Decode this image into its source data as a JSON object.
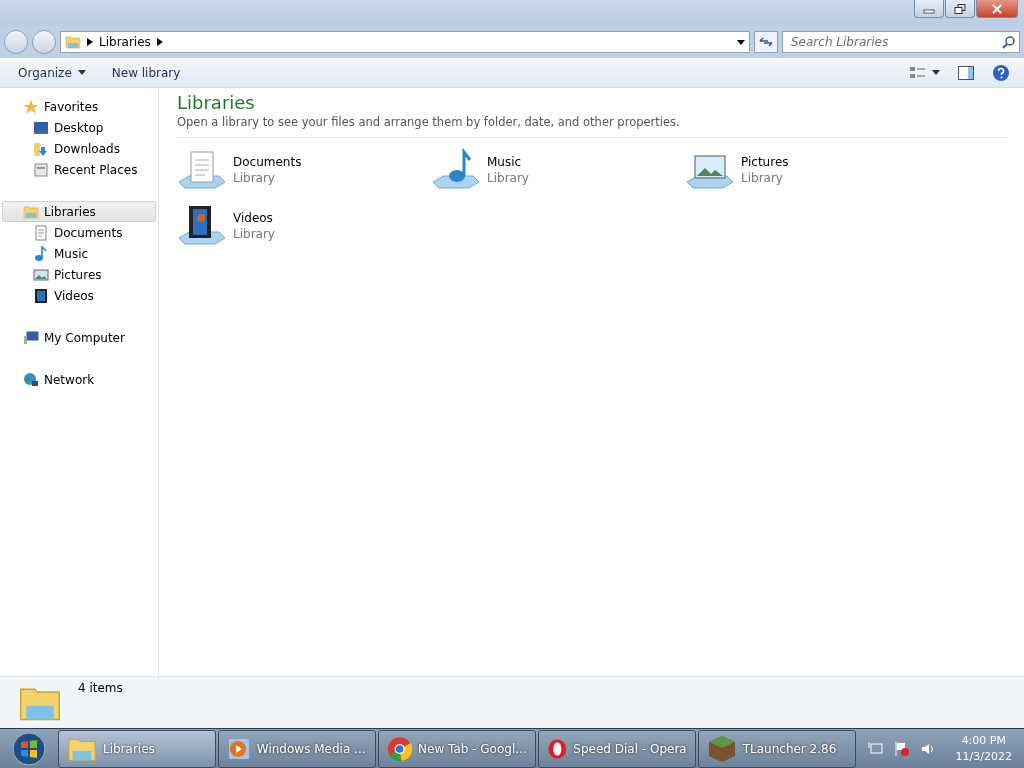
{
  "address_bar": {
    "path": "Libraries"
  },
  "search": {
    "placeholder": "Search Libraries"
  },
  "toolbar": {
    "buttons": [
      "Organize",
      "New library"
    ]
  },
  "nav": [
    {
      "label": "Favorites",
      "selected": false,
      "children": [
        {
          "label": "Desktop",
          "selected": false
        },
        {
          "label": "Downloads",
          "selected": false
        },
        {
          "label": "Recent Places",
          "selected": false
        }
      ]
    },
    {
      "label": "Libraries",
      "selected": true,
      "children": [
        {
          "label": "Documents",
          "selected": false
        },
        {
          "label": "Music",
          "selected": false
        },
        {
          "label": "Pictures",
          "selected": false
        },
        {
          "label": "Videos",
          "selected": false
        }
      ]
    },
    {
      "label": "My Computer",
      "selected": false
    },
    {
      "label": "Network",
      "selected": false
    }
  ],
  "content": {
    "title": "Libraries",
    "description": "Open a library to see your files and arrange them by folder, date, and other properties.",
    "items": [
      {
        "name": "Documents",
        "type": "Library"
      },
      {
        "name": "Music",
        "type": "Library"
      },
      {
        "name": "Pictures",
        "type": "Library"
      },
      {
        "name": "Videos",
        "type": "Library"
      }
    ]
  },
  "status_bar": {
    "count": "4 items"
  },
  "taskbar": {
    "buttons": [
      {
        "label": "Libraries",
        "selected": true
      },
      {
        "label": "Windows Media ...",
        "selected": false
      },
      {
        "label": "New Tab - Googl...",
        "selected": false
      },
      {
        "label": "Speed Dial - Opera",
        "selected": false
      },
      {
        "label": "TLauncher 2.86",
        "selected": false
      }
    ],
    "clock": {
      "time": "4:00 PM",
      "date": "11/3/2022"
    }
  }
}
